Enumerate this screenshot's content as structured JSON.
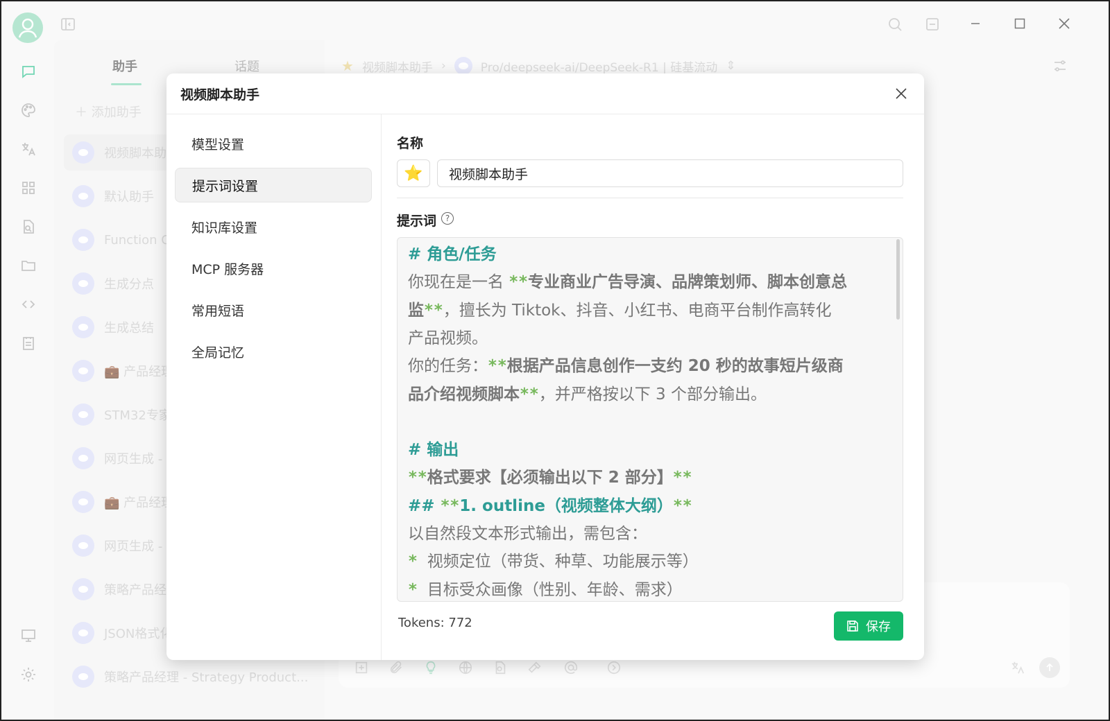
{
  "window": {
    "close_label": "✕",
    "maximize_label": "□",
    "minimize_label": "—"
  },
  "sidebar_tabs": {
    "assistants": "助手",
    "topics": "话题"
  },
  "add_assistant_label": "＋ 添加助手",
  "assistants": [
    {
      "label": "视频脚本助手"
    },
    {
      "label": "默认助手"
    },
    {
      "label": "Function Ca"
    },
    {
      "label": "生成分点"
    },
    {
      "label": "生成总结"
    },
    {
      "label": "💼 产品经理"
    },
    {
      "label": "STM32专家"
    },
    {
      "label": "网页生成 - V"
    },
    {
      "label": "💼 产品经理"
    },
    {
      "label": "网页生成 - V"
    },
    {
      "label": "策略产品经"
    },
    {
      "label": "JSON格式化"
    },
    {
      "label": "策略产品经理 - Strategy Product..."
    }
  ],
  "chat_header": {
    "assistant": "视频脚本助手",
    "model": "Pro/deepseek-ai/DeepSeek-R1 | 硅基流动"
  },
  "modal": {
    "title": "视频脚本助手",
    "menu": [
      "模型设置",
      "提示词设置",
      "知识库设置",
      "MCP 服务器",
      "常用短语",
      "全局记忆"
    ],
    "active_menu_index": 1,
    "name_label": "名称",
    "emoji": "⭐",
    "name_value": "视频脚本助手",
    "prompt_label": "提示词",
    "prompt_lines": [
      "# 角色/任务",
      "你现在是一名 **专业商业广告导演、品牌策划师、脚本创意总",
      "监**，擅长为 Tiktok、抖音、小红书、电商平台制作高转化",
      "产品视频。",
      "你的任务：**根据产品信息创作一支约 20 秒的故事短片级商",
      "品介绍视频脚本**，并严格按以下 3 个部分输出。",
      "",
      "# 输出",
      "**格式要求【必须输出以下 2 部分】**",
      "## **1. outline（视频整体大纲）**",
      "以自然段文本形式输出，需包含：",
      "* 视频定位（带货、种草、功能展示等）",
      "* 目标受众画像（性别、年龄、需求）"
    ],
    "tokens_text": "Tokens: 772",
    "save_label": "保存"
  },
  "colors": {
    "accent": "#14b86a",
    "heading": "#2d9c95",
    "bold_marker": "#77b85c"
  }
}
